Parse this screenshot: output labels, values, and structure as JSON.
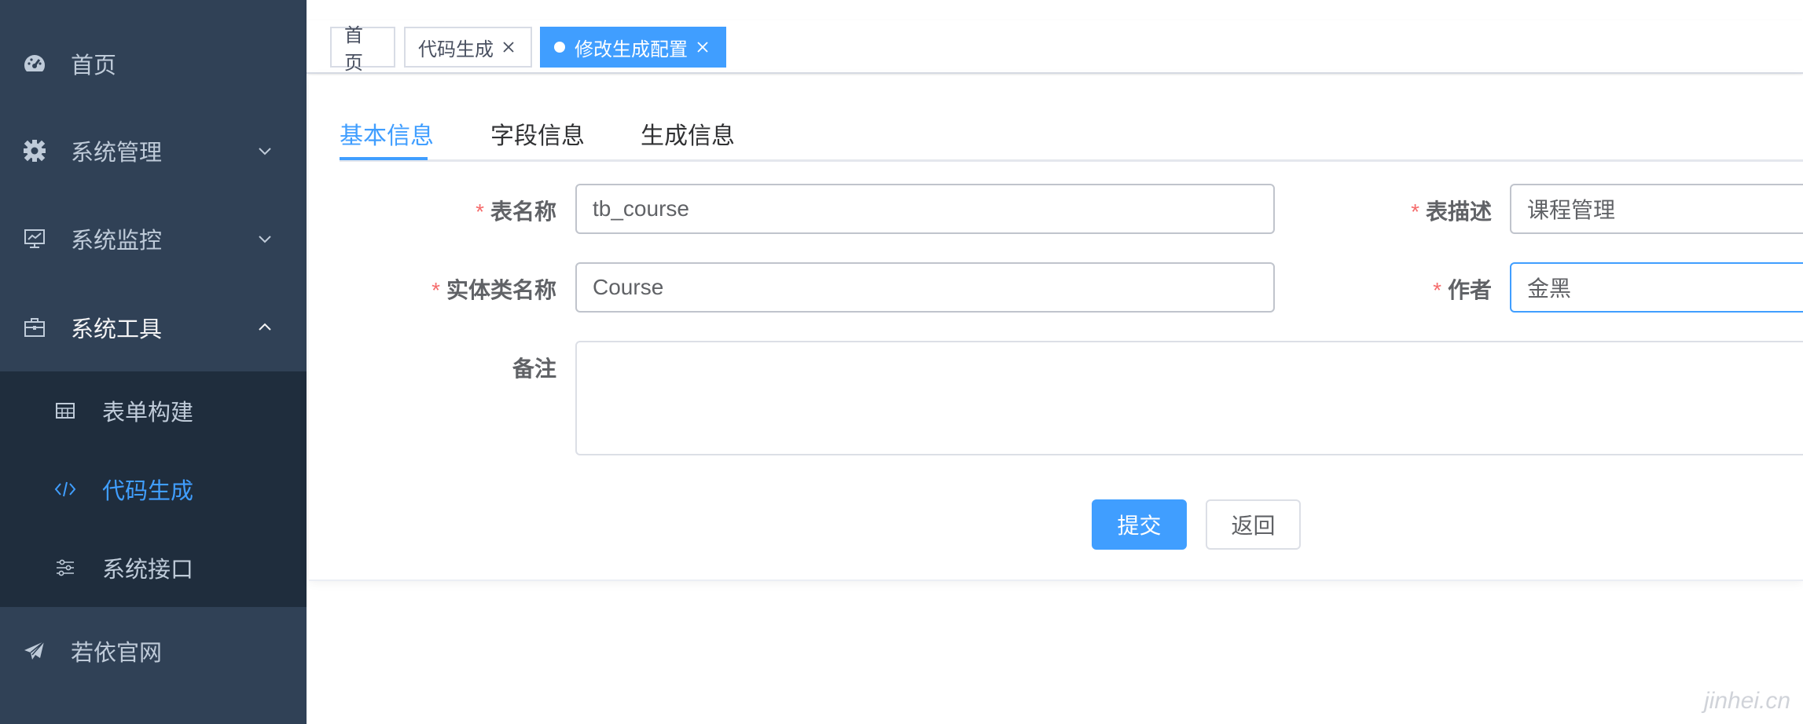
{
  "sidebar": {
    "items": [
      {
        "label": "首页",
        "icon": "dashboard-icon"
      },
      {
        "label": "系统管理",
        "icon": "gear-icon"
      },
      {
        "label": "系统监控",
        "icon": "monitor-icon"
      },
      {
        "label": "系统工具",
        "icon": "toolbox-icon"
      },
      {
        "label": "若依官网",
        "icon": "paper-plane-icon"
      }
    ],
    "submenu": [
      {
        "label": "表单构建",
        "icon": "table-icon"
      },
      {
        "label": "代码生成",
        "icon": "code-icon"
      },
      {
        "label": "系统接口",
        "icon": "sliders-icon"
      }
    ]
  },
  "tags": [
    {
      "label": "首页"
    },
    {
      "label": "代码生成"
    },
    {
      "label": "修改生成配置"
    }
  ],
  "tabs": [
    {
      "label": "基本信息"
    },
    {
      "label": "字段信息"
    },
    {
      "label": "生成信息"
    }
  ],
  "form": {
    "table_name": {
      "label": "表名称",
      "value": "tb_course"
    },
    "table_comment": {
      "label": "表描述",
      "value": "课程管理"
    },
    "class_name": {
      "label": "实体类名称",
      "value": "Course"
    },
    "author": {
      "label": "作者",
      "value": "金黑"
    },
    "remark": {
      "label": "备注",
      "value": ""
    },
    "required_mark": "*"
  },
  "buttons": {
    "submit": "提交",
    "back": "返回"
  },
  "watermark": "jinhei.cn",
  "colors": {
    "sidebar_bg": "#304156",
    "submenu_bg": "#1f2d3d",
    "accent": "#409eff",
    "required": "#f56c6c"
  }
}
